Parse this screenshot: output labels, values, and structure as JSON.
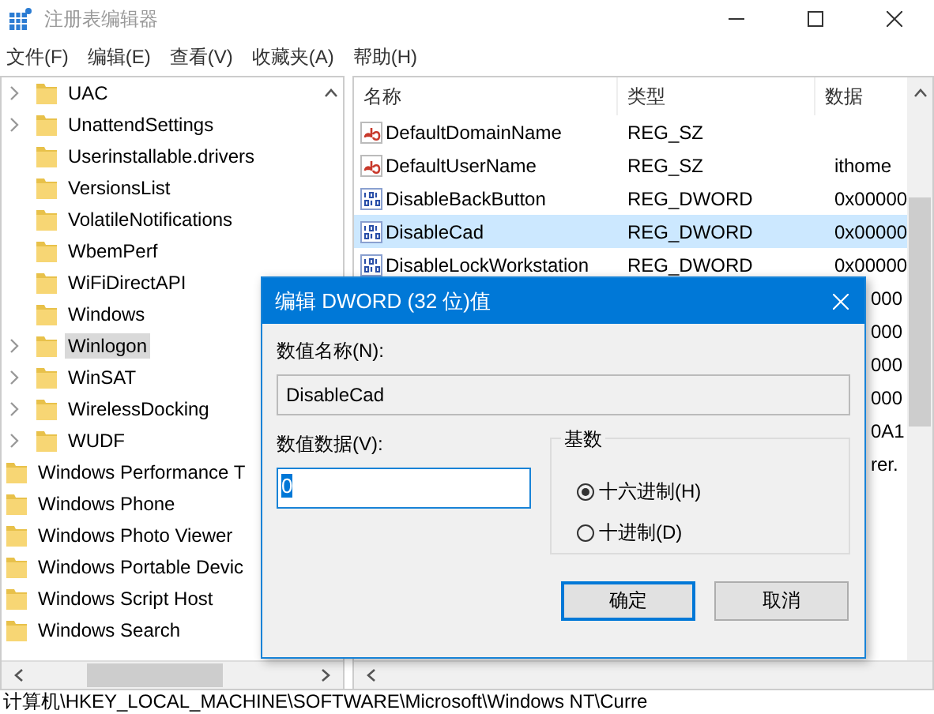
{
  "window": {
    "title": "注册表编辑器"
  },
  "menu": [
    {
      "label": "文件(F)"
    },
    {
      "label": "编辑(E)"
    },
    {
      "label": "查看(V)"
    },
    {
      "label": "收藏夹(A)"
    },
    {
      "label": "帮助(H)"
    }
  ],
  "tree": [
    {
      "children": [
        {
          "label": "UAC",
          "expandable": true,
          "selected": false
        },
        {
          "label": "UnattendSettings",
          "expandable": true,
          "selected": false
        },
        {
          "label": "Userinstallable.drivers",
          "expandable": false,
          "selected": false
        },
        {
          "label": "VersionsList",
          "expandable": false,
          "selected": false
        },
        {
          "label": "VolatileNotifications",
          "expandable": false,
          "selected": false
        },
        {
          "label": "WbemPerf",
          "expandable": false,
          "selected": false
        },
        {
          "label": "WiFiDirectAPI",
          "expandable": false,
          "selected": false
        },
        {
          "label": "Windows",
          "expandable": false,
          "selected": false
        },
        {
          "label": "Winlogon",
          "expandable": true,
          "selected": true
        },
        {
          "label": "WinSAT",
          "expandable": true,
          "selected": false
        },
        {
          "label": "WirelessDocking",
          "expandable": true,
          "selected": false
        },
        {
          "label": "WUDF",
          "expandable": true,
          "selected": false
        }
      ]
    },
    {
      "label": "Windows Performance T",
      "selected": false
    },
    {
      "label": "Windows Phone",
      "selected": false
    },
    {
      "label": "Windows Photo Viewer",
      "selected": false
    },
    {
      "label": "Windows Portable Devic",
      "selected": false
    },
    {
      "label": "Windows Script Host",
      "selected": false
    },
    {
      "label": "Windows Search",
      "selected": false
    }
  ],
  "table": {
    "columns": [
      "名称",
      "类型",
      "数据"
    ],
    "rows": [
      {
        "kind": "string",
        "name": "DefaultDomainName",
        "type": "REG_SZ",
        "selected": false
      },
      {
        "kind": "string",
        "name": "DefaultUserName",
        "type": "REG_SZ",
        "data": "ithome",
        "selected": false
      },
      {
        "kind": "dword",
        "name": "DisableBackButton",
        "type": "REG_DWORD",
        "data": "0x00000",
        "selected": false
      },
      {
        "kind": "dword",
        "name": "DisableCad",
        "type": "REG_DWORD",
        "data": "0x00000",
        "selected": true
      },
      {
        "kind": "dword",
        "name": "DisableLockWorkstation",
        "type": "REG_DWORD",
        "data": "0x00000",
        "selected": false
      },
      {
        "kind": "covered",
        "data": "000"
      },
      {
        "kind": "covered",
        "data": "000"
      },
      {
        "kind": "covered",
        "data": "000"
      },
      {
        "kind": "covered",
        "data": "000"
      },
      {
        "kind": "covered",
        "data": "0A1"
      },
      {
        "kind": "covered",
        "data": "rer."
      }
    ]
  },
  "status_bar": "计算机\\HKEY_LOCAL_MACHINE\\SOFTWARE\\Microsoft\\Windows NT\\Curre",
  "dialog": {
    "title": "编辑 DWORD (32 位)值",
    "value_name": {
      "label": "数值名称(N):",
      "value": "DisableCad"
    },
    "value_data": {
      "label": "数值数据(V):",
      "value": "0"
    },
    "base": {
      "label": "基数",
      "options": [
        {
          "label": "十六进制(H)",
          "selected": true
        },
        {
          "label": "十进制(D)",
          "selected": false
        }
      ]
    },
    "buttons": [
      {
        "label": "确定",
        "default": true
      },
      {
        "label": "取消",
        "default": false
      }
    ]
  }
}
